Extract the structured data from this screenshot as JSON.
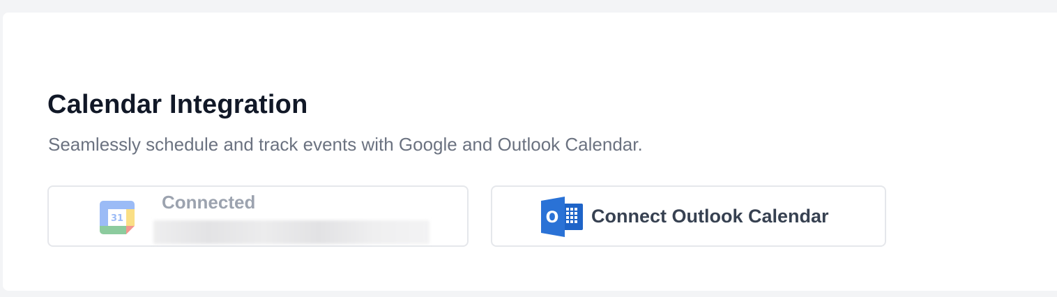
{
  "section": {
    "title": "Calendar Integration",
    "subtitle": "Seamlessly schedule and track events with Google and Outlook Calendar."
  },
  "google": {
    "status": "Connected",
    "icon_day": "31",
    "icon": "google-calendar-icon"
  },
  "outlook": {
    "button_label": "Connect Outlook Calendar",
    "icon": "outlook-icon",
    "icon_letter": "O"
  },
  "colors": {
    "page_bg": "#f3f4f6",
    "panel_bg": "#ffffff",
    "title": "#111827",
    "subtitle": "#6b7280",
    "border": "#e5e7eb",
    "outlook_blue": "#1e64c8"
  }
}
